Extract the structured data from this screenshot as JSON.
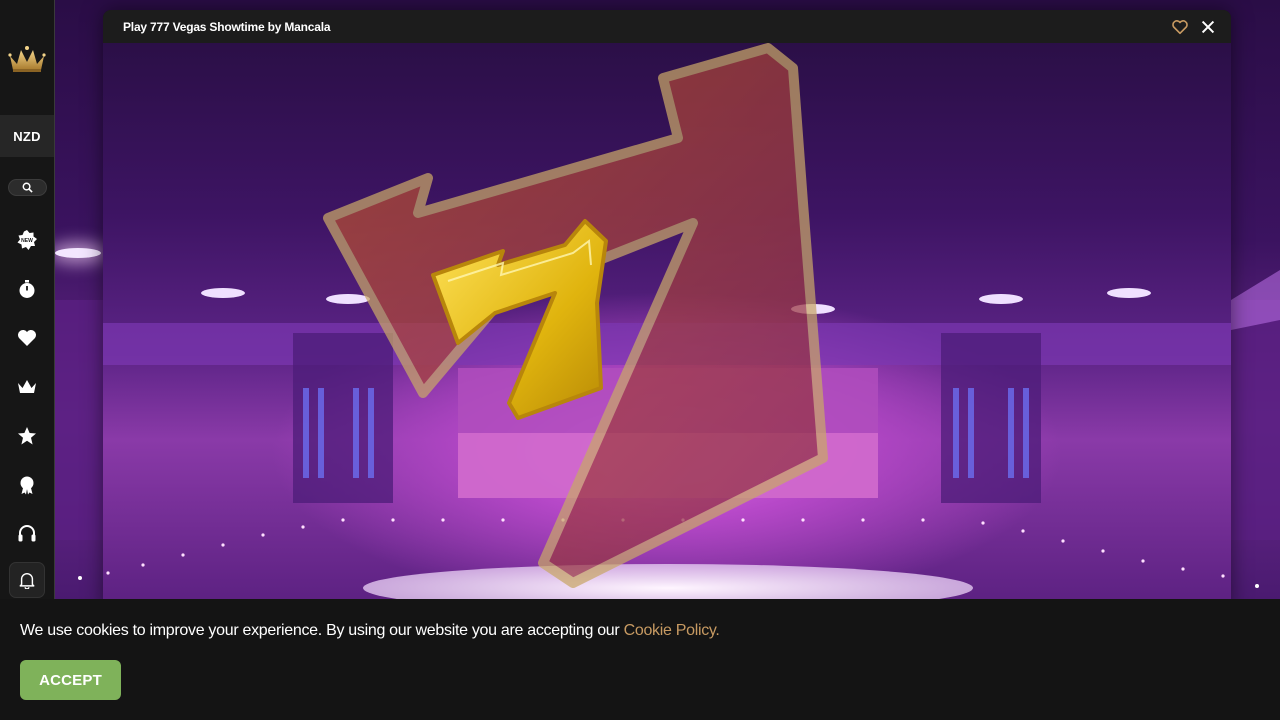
{
  "sidebar": {
    "currency": "NZD",
    "icons": [
      "crown-logo-icon",
      "search-icon",
      "new-badge-icon",
      "stopwatch-icon",
      "heart-icon",
      "crown-icon",
      "star-icon",
      "trophy-icon",
      "headset-icon",
      "bell-icon"
    ]
  },
  "game_window": {
    "title": "Play 777 Vegas Showtime by Mancala",
    "favorite_icon": "heart-outline-icon",
    "close_icon": "close-icon"
  },
  "cookie_banner": {
    "message": "We use cookies to improve your experience. By using our website you are accepting our",
    "link_label": "Cookie Policy.",
    "accept_label": "ACCEPT"
  },
  "colors": {
    "sidebar_bg": "#161616",
    "accent_gold": "#c79a62",
    "accept_green": "#7fb25a",
    "banner_bg": "#141414"
  }
}
